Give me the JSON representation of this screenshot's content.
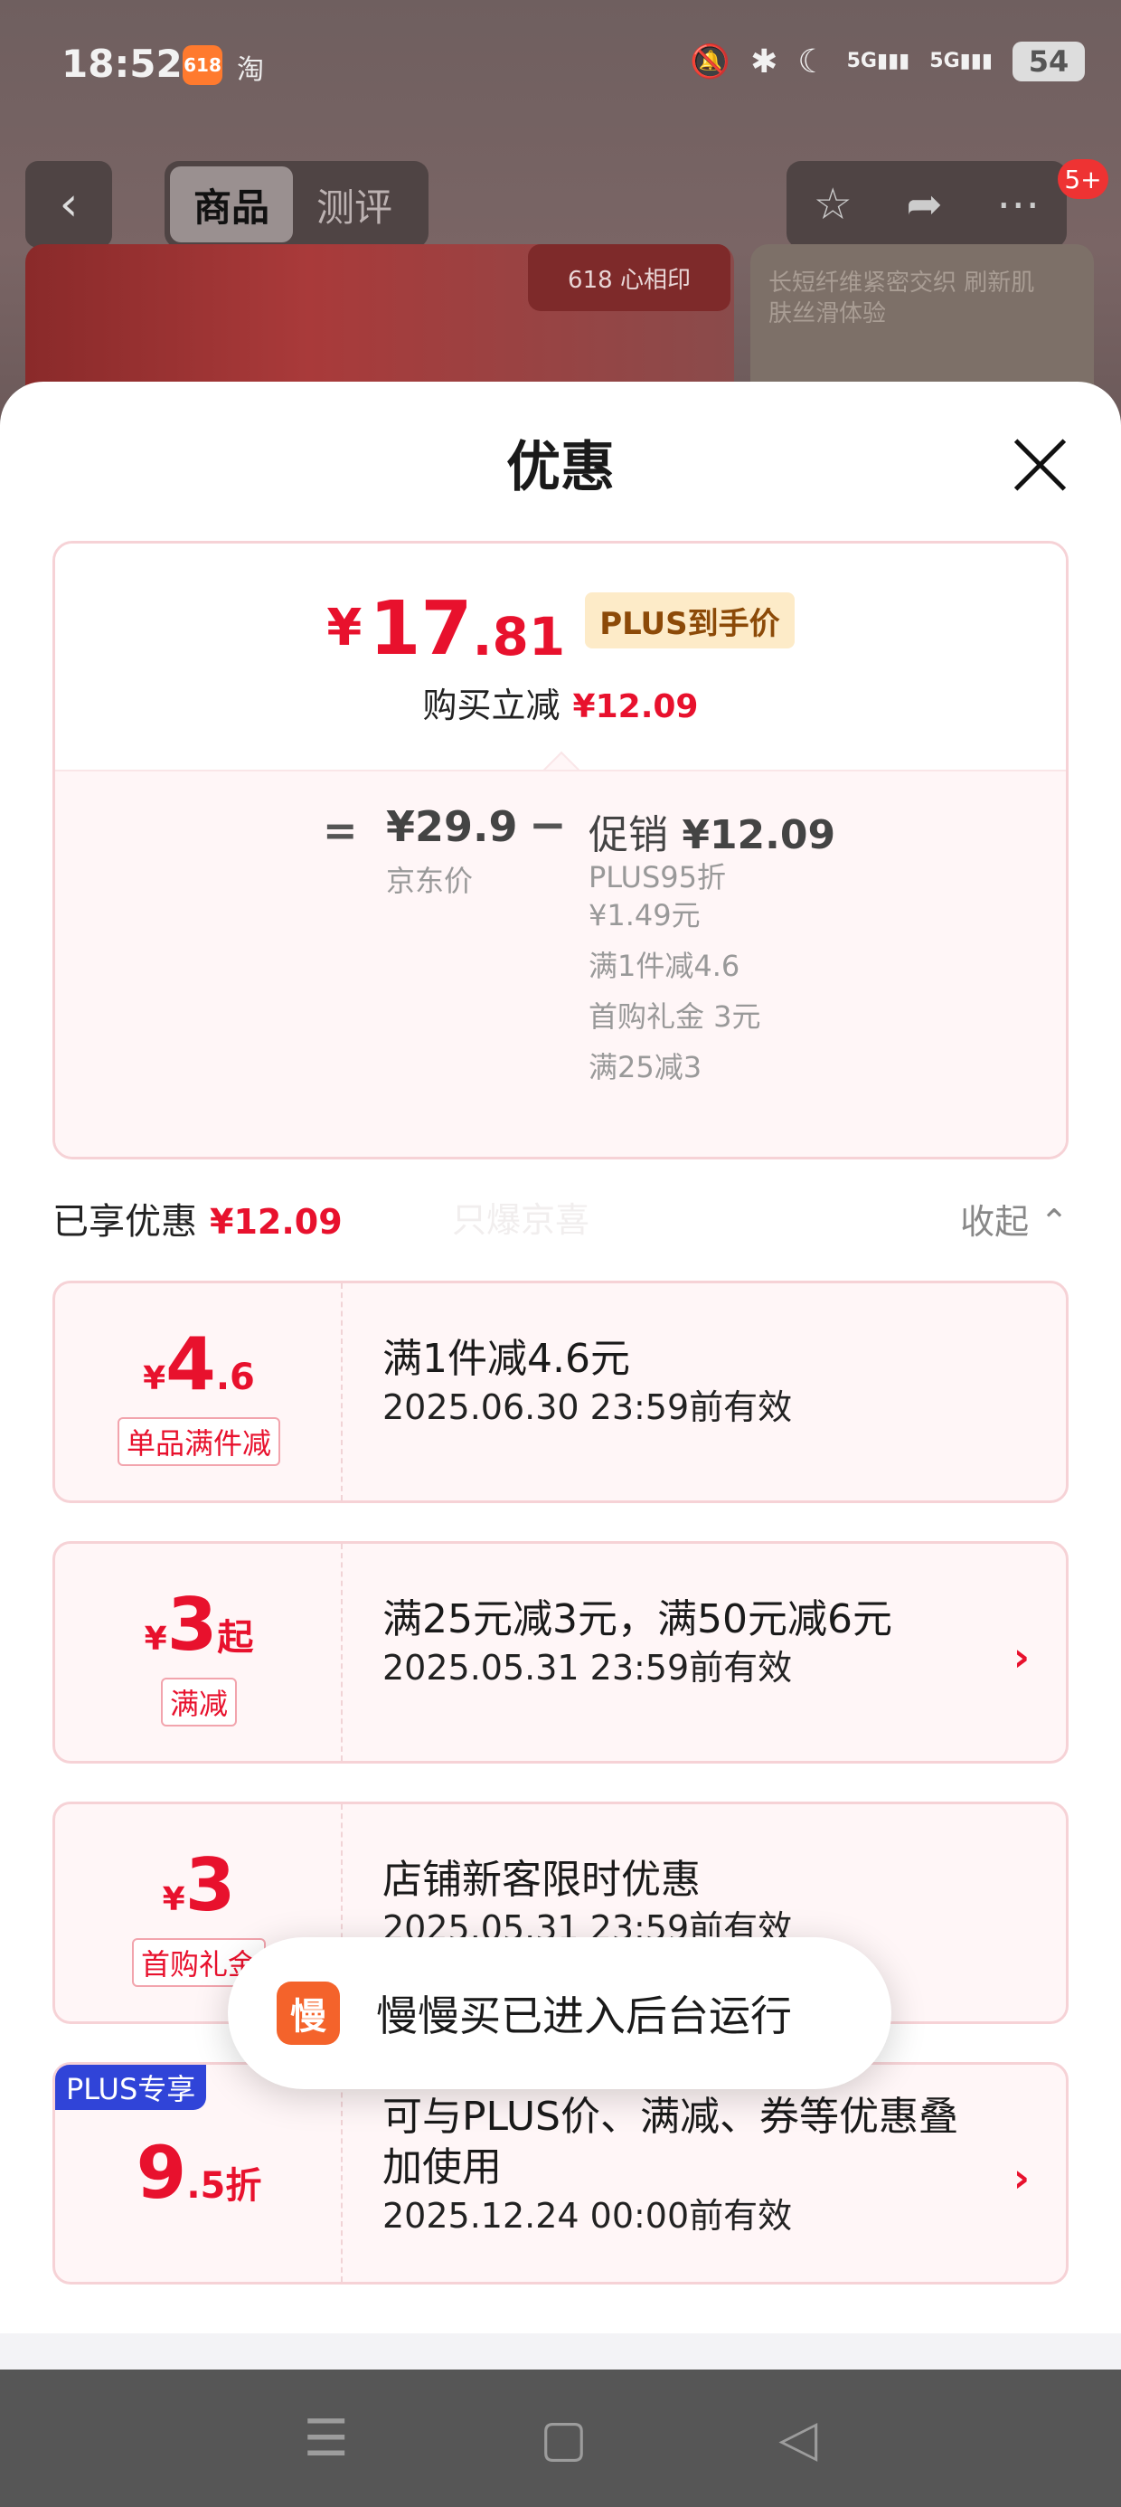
{
  "status_bar": {
    "time": "18:52",
    "app_icon": "淘",
    "battery": "54",
    "signal1": "5G",
    "signal2": "5G",
    "icons": [
      "mute-icon",
      "bluetooth-icon",
      "moon-icon",
      "signal-icon",
      "battery-icon"
    ]
  },
  "background": {
    "tabs": [
      "商品",
      "测评"
    ],
    "active_tab": "商品",
    "badge": "5+",
    "brand_chip": "618 心相印",
    "product_text": "长短纤维紧密交织 刷新肌肤丝滑体验"
  },
  "sheet": {
    "title": "优惠",
    "summary": {
      "yen": "¥",
      "price_int": "17",
      "price_dec": ".81",
      "plus_tag": "PLUS到手价",
      "reduce_label": "购买立减",
      "reduce_value": "¥12.09",
      "eq": "=",
      "jd_price": "¥29.9",
      "jd_label": "京东价",
      "minus": "−",
      "promo_label": "促销",
      "promo_value": "¥12.09",
      "promo_items": [
        "PLUS95折 ¥1.49元",
        "满1件减4.6",
        "首购礼金 3元",
        "满25减3"
      ]
    },
    "enjoyed_label": "已享优惠",
    "enjoyed_value": "¥12.09",
    "watermark": "只爆京喜",
    "collapse_label": "收起 ⌃",
    "coupons": [
      {
        "yen": "¥",
        "big": "4",
        "small": ".6",
        "tag": "单品满件减",
        "title": "满1件减4.6元",
        "valid": "2025.06.30 23:59前有效",
        "arrow": ""
      },
      {
        "yen": "¥",
        "big": "3",
        "small": "起",
        "tag": "满减",
        "title": "满25元减3元，满50元减6元",
        "valid": "2025.05.31 23:59前有效",
        "arrow": "›"
      },
      {
        "yen": "¥",
        "big": "3",
        "small": "",
        "tag": "首购礼金",
        "title": "店铺新客限时优惠",
        "valid": "2025.05.31 23:59前有效",
        "arrow": ""
      },
      {
        "yen": "",
        "big": "9",
        "small": ".5折",
        "tag": "",
        "corner": "PLUS专享",
        "title": "可与PLUS价、满减、券等优惠叠加使用",
        "valid": "2025.12.24 00:00前有效",
        "arrow": "›"
      }
    ]
  },
  "toast": {
    "icon_label": "慢",
    "text": "慢慢买已进入后台运行"
  },
  "system_nav": {
    "menu": "☰",
    "home": "▢",
    "back": "◁"
  }
}
